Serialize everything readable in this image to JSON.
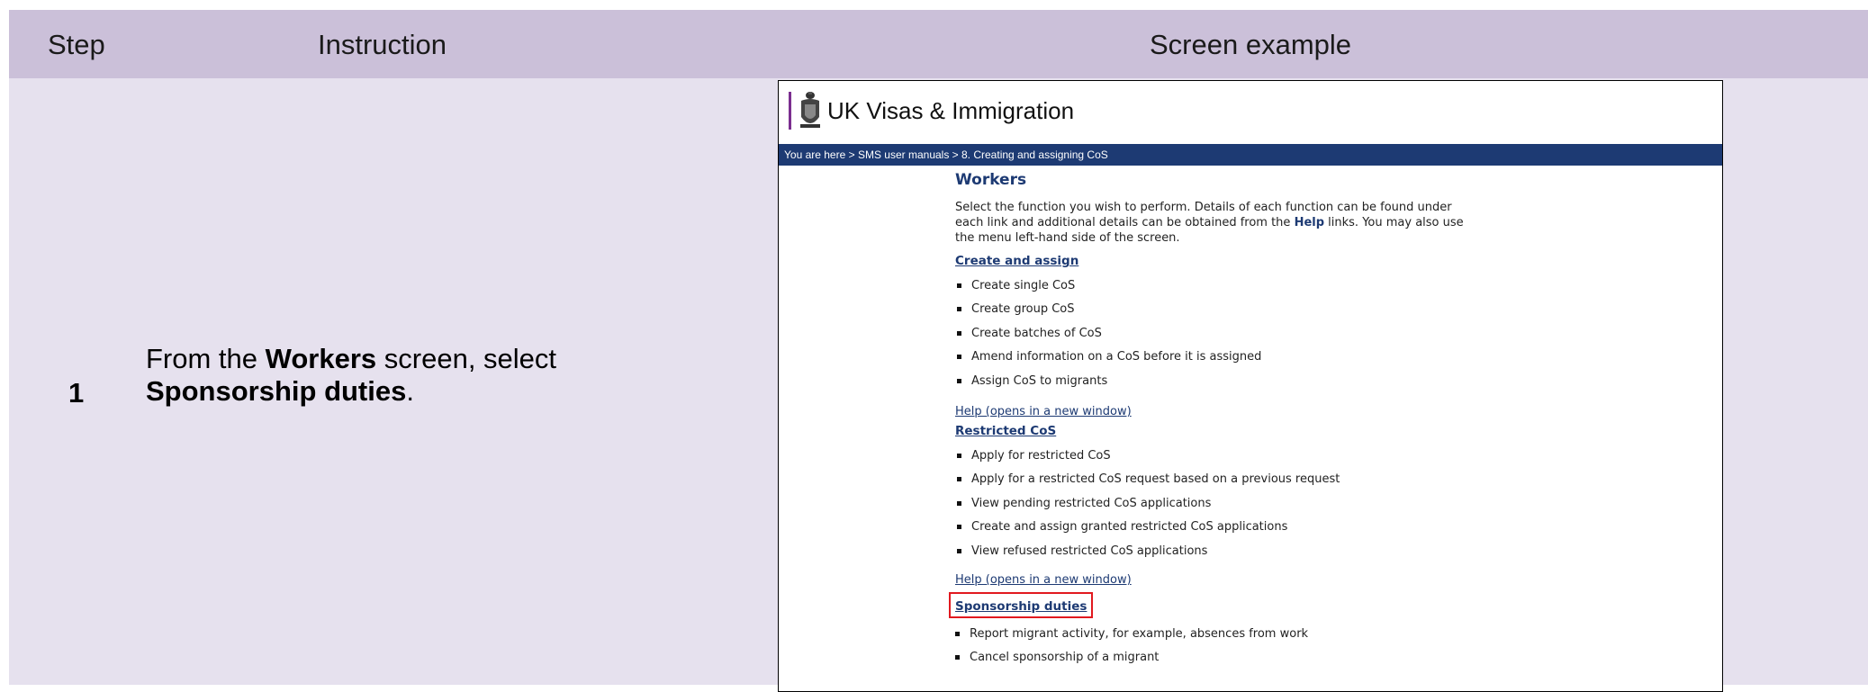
{
  "header": {
    "col_step": "Step",
    "col_instruction": "Instruction",
    "col_screen": "Screen example"
  },
  "row": {
    "step": "1",
    "instruction_pre": "From the ",
    "instruction_bold1": "Workers",
    "instruction_mid": " screen, select ",
    "instruction_bold2": "Sponsorship duties",
    "instruction_post": "."
  },
  "screenshot": {
    "brand": "UK Visas & Immigration",
    "breadcrumb": "You are here > SMS user manuals >  8. Creating and assigning CoS",
    "heading": "Workers",
    "intro_pre": "Select the function you wish to perform. Details of each function can be found under each link and additional details can be obtained from the ",
    "intro_bold": "Help",
    "intro_post": " links. You may also use the menu left-hand side of the screen.",
    "sections": [
      {
        "title": "Create and assign",
        "items": [
          "Create single CoS",
          "Create group CoS",
          "Create batches of CoS",
          "Amend information on a CoS before it is assigned",
          "Assign CoS to migrants"
        ],
        "help": "Help (opens in a new window)"
      },
      {
        "title": "Restricted CoS",
        "items": [
          "Apply for restricted CoS",
          "Apply for a restricted CoS request based on a previous request",
          "View pending restricted CoS applications",
          "Create and assign granted restricted CoS applications",
          "View refused restricted CoS applications"
        ],
        "help": "Help (opens in a new window)"
      },
      {
        "title": "Sponsorship duties",
        "items": [
          "Report migrant activity, for example, absences from work",
          "Cancel sponsorship of a migrant"
        ]
      }
    ],
    "highlight_color": "#e1191f"
  }
}
